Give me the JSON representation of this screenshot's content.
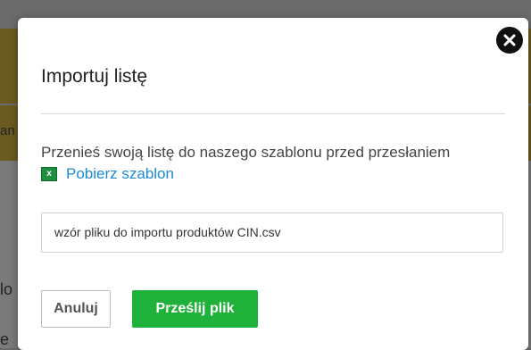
{
  "background": {
    "fragment_top": "an",
    "fragment_mid": "lo",
    "fragment_bottom": "e"
  },
  "modal": {
    "title": "Importuj listę",
    "instructions": "Przenieś swoją listę do naszego szablonu przed przesłaniem",
    "template_link_label": "Pobierz szablon",
    "template_icon": "excel-icon",
    "file_input_value": "wzór pliku do importu produktów CIN.csv",
    "cancel_label": "Anuluj",
    "upload_label": "Prześlij plik",
    "close_icon": "close-icon"
  },
  "colors": {
    "upload_button": "#1fb13a",
    "link": "#1a8ad4",
    "excel_icon": "#1e8f3e"
  }
}
